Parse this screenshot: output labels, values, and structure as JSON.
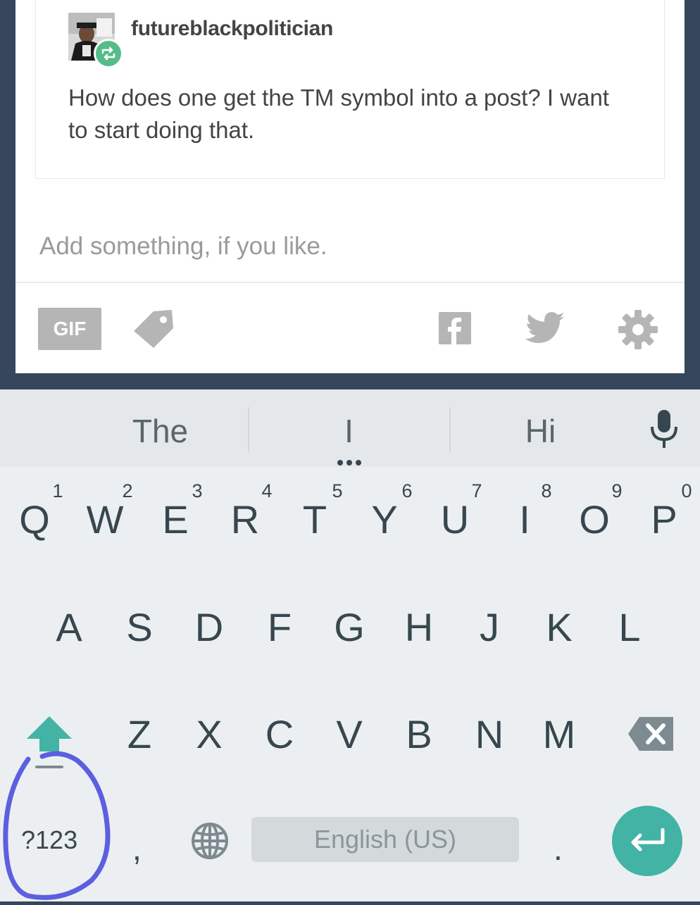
{
  "post": {
    "username": "futureblackpolitician",
    "text": "How does one get the TM symbol into a post? I want to start doing that."
  },
  "composer": {
    "placeholder": "Add something, if you like.",
    "gif_label": "GIF"
  },
  "keyboard": {
    "suggestions": [
      "The",
      "I",
      "Hi"
    ],
    "row1": [
      "Q",
      "W",
      "E",
      "R",
      "T",
      "Y",
      "U",
      "I",
      "O",
      "P"
    ],
    "row1_hints": [
      "1",
      "2",
      "3",
      "4",
      "5",
      "6",
      "7",
      "8",
      "9",
      "0"
    ],
    "row2": [
      "A",
      "S",
      "D",
      "F",
      "G",
      "H",
      "J",
      "K",
      "L"
    ],
    "row3": [
      "Z",
      "X",
      "C",
      "V",
      "B",
      "N",
      "M"
    ],
    "symbols_label": "?123",
    "comma_label": ",",
    "period_label": ".",
    "space_label": "English (US)"
  },
  "colors": {
    "accent": "#42b3a4",
    "reblog_green": "#56bc8a",
    "background": "#36465d",
    "annotation": "#5b5fe0"
  }
}
